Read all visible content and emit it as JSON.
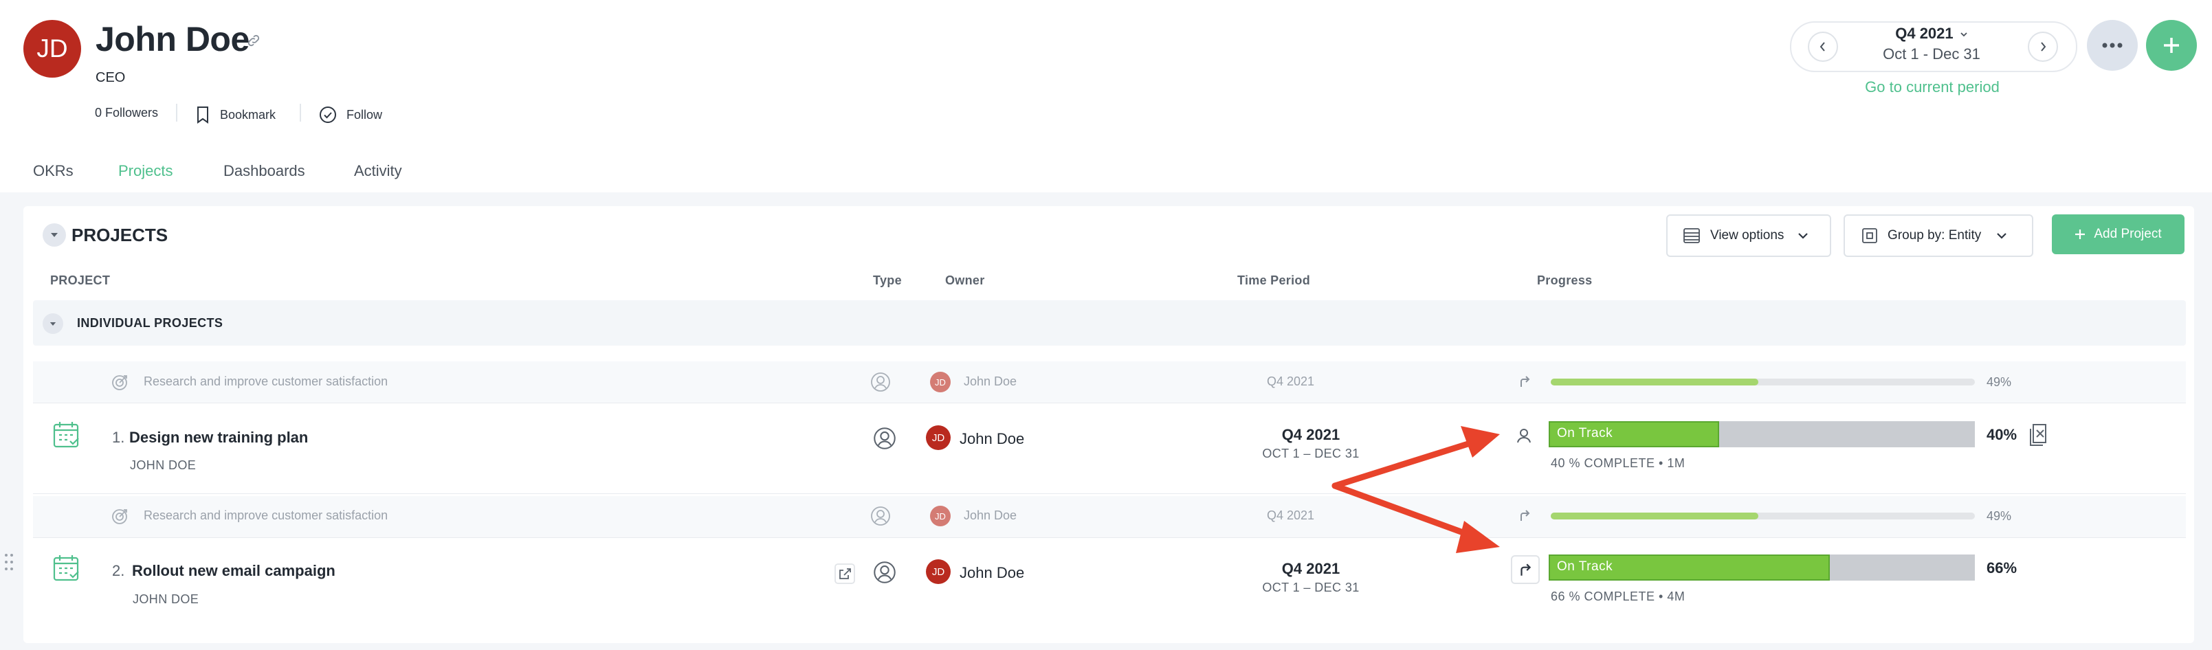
{
  "profile": {
    "initials": "JD",
    "name": "John Doe",
    "title": "CEO",
    "followers": "0 Followers",
    "bookmark": "Bookmark",
    "follow": "Follow"
  },
  "period": {
    "label": "Q4 2021",
    "range": "Oct 1 - Dec 31",
    "go_current": "Go to current period"
  },
  "tabs": [
    {
      "label": "OKRs",
      "active": false
    },
    {
      "label": "Projects",
      "active": true
    },
    {
      "label": "Dashboards",
      "active": false
    },
    {
      "label": "Activity",
      "active": false
    }
  ],
  "projects": {
    "section_title": "PROJECTS",
    "view_options": "View options",
    "group_by": "Group by: Entity",
    "add_project": "Add Project",
    "columns": {
      "project": "PROJECT",
      "type": "Type",
      "owner": "Owner",
      "time_period": "Time Period",
      "progress": "Progress"
    },
    "group_label": "INDIVIDUAL PROJECTS",
    "rows": [
      {
        "parent": {
          "title": "Research and improve customer satisfaction",
          "owner_initials": "JD",
          "owner": "John Doe",
          "period": "Q4 2021",
          "progress": 49,
          "progress_label": "49%"
        },
        "number": "1.",
        "title": "Design new training plan",
        "owner_sub": "JOHN DOE",
        "owner_initials": "JD",
        "owner": "John Doe",
        "period": "Q4 2021",
        "period_range": "OCT 1 – DEC 31",
        "status": "On Track",
        "progress": 40,
        "progress_label": "40%",
        "complete_text": "40 % COMPLETE • 1M"
      },
      {
        "parent": {
          "title": "Research and improve customer satisfaction",
          "owner_initials": "JD",
          "owner": "John Doe",
          "period": "Q4 2021",
          "progress": 49,
          "progress_label": "49%"
        },
        "number": "2.",
        "title": "Rollout new email campaign",
        "owner_sub": "JOHN DOE",
        "owner_initials": "JD",
        "owner": "John Doe",
        "period": "Q4 2021",
        "period_range": "OCT 1 – DEC 31",
        "status": "On Track",
        "progress": 66,
        "progress_label": "66%",
        "complete_text": "66 % COMPLETE • 4M"
      }
    ]
  },
  "colors": {
    "accent_green": "#4fc08d",
    "avatar_red": "#b92a1f",
    "progress_green": "#79c63f",
    "annotation_red": "#e8432b"
  },
  "icons": {
    "link": "link-icon",
    "bookmark": "bookmark-icon",
    "follow": "check-circle-icon",
    "prev": "chevron-left-icon",
    "next": "chevron-right-icon",
    "more": "ellipsis-icon",
    "add": "plus-icon",
    "project_type": "user-circle-icon",
    "project": "calendar-project-icon",
    "objective": "target-icon"
  }
}
